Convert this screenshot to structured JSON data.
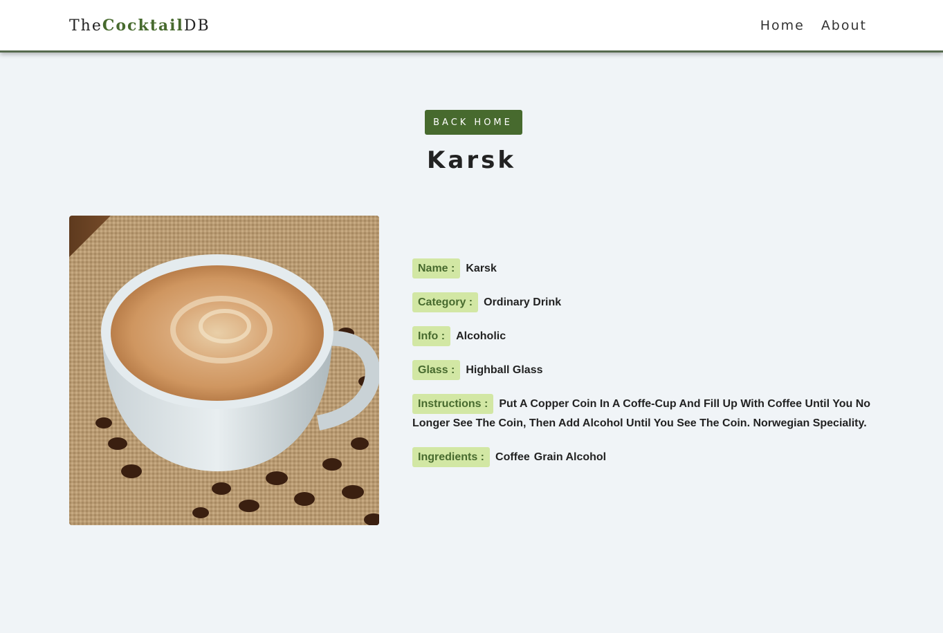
{
  "navbar": {
    "logo_prefix": "The",
    "logo_brand": "Cocktail",
    "logo_suffix": "DB",
    "links": [
      "Home",
      "About"
    ]
  },
  "page": {
    "back_button_label": "Back Home",
    "title": "Karsk"
  },
  "drink": {
    "image_alt": "Karsk",
    "fields": {
      "name": {
        "label": "Name :",
        "value": "Karsk"
      },
      "category": {
        "label": "Category :",
        "value": "Ordinary Drink"
      },
      "info": {
        "label": "Info :",
        "value": "Alcoholic"
      },
      "glass": {
        "label": "Glass :",
        "value": "Highball Glass"
      },
      "instructions": {
        "label": "Instructions :",
        "value": "Put A Copper Coin In A Coffe-Cup And Fill Up With Coffee Until You No Longer See The Coin, Then Add Alcohol Until You See The Coin. Norwegian Speciality."
      },
      "ingredients": {
        "label": "Ingredients :",
        "values": [
          "Coffee",
          "Grain Alcohol"
        ]
      }
    }
  },
  "colors": {
    "accent": "#476a2e",
    "tag_background": "#d2e7a4",
    "page_background": "#f0f4f7",
    "navbar_border": "#566a4e"
  }
}
